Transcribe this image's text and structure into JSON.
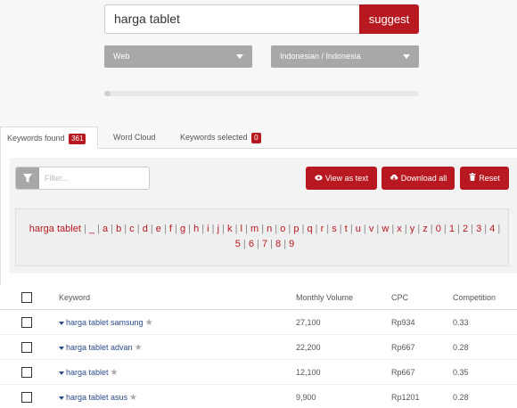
{
  "search": {
    "value": "harga tablet",
    "button": "suggest"
  },
  "filters": {
    "source": "Web",
    "language": "Indonesian / Indonesia"
  },
  "progress": {
    "fraction": 0.02
  },
  "tabs": [
    {
      "label": "Keywords found",
      "badge": "361"
    },
    {
      "label": "Word Cloud"
    },
    {
      "label": "Keywords selected",
      "badge": "0"
    }
  ],
  "toolbar": {
    "filter_placeholder": "Filter...",
    "view_label": "View as text",
    "download_label": "Download all",
    "reset_label": "Reset"
  },
  "alphabet": {
    "lead": "harga tablet",
    "items": [
      "_",
      "a",
      "b",
      "c",
      "d",
      "e",
      "f",
      "g",
      "h",
      "i",
      "j",
      "k",
      "l",
      "m",
      "n",
      "o",
      "p",
      "q",
      "r",
      "s",
      "t",
      "u",
      "v",
      "w",
      "x",
      "y",
      "z",
      "0",
      "1",
      "2",
      "3",
      "4",
      "5",
      "6",
      "7",
      "8",
      "9"
    ]
  },
  "table": {
    "headers": {
      "keyword": "Keyword",
      "volume": "Monthly Volume",
      "cpc": "CPC",
      "competition": "Competition"
    },
    "rows": [
      {
        "keyword": "harga tablet samsung",
        "volume": "27,100",
        "cpc": "Rp934",
        "competition": "0.33"
      },
      {
        "keyword": "harga tablet advan",
        "volume": "22,200",
        "cpc": "Rp667",
        "competition": "0.28"
      },
      {
        "keyword": "harga tablet",
        "volume": "12,100",
        "cpc": "Rp667",
        "competition": "0.35"
      },
      {
        "keyword": "harga tablet asus",
        "volume": "9,900",
        "cpc": "Rp1201",
        "competition": "0.28"
      }
    ]
  }
}
